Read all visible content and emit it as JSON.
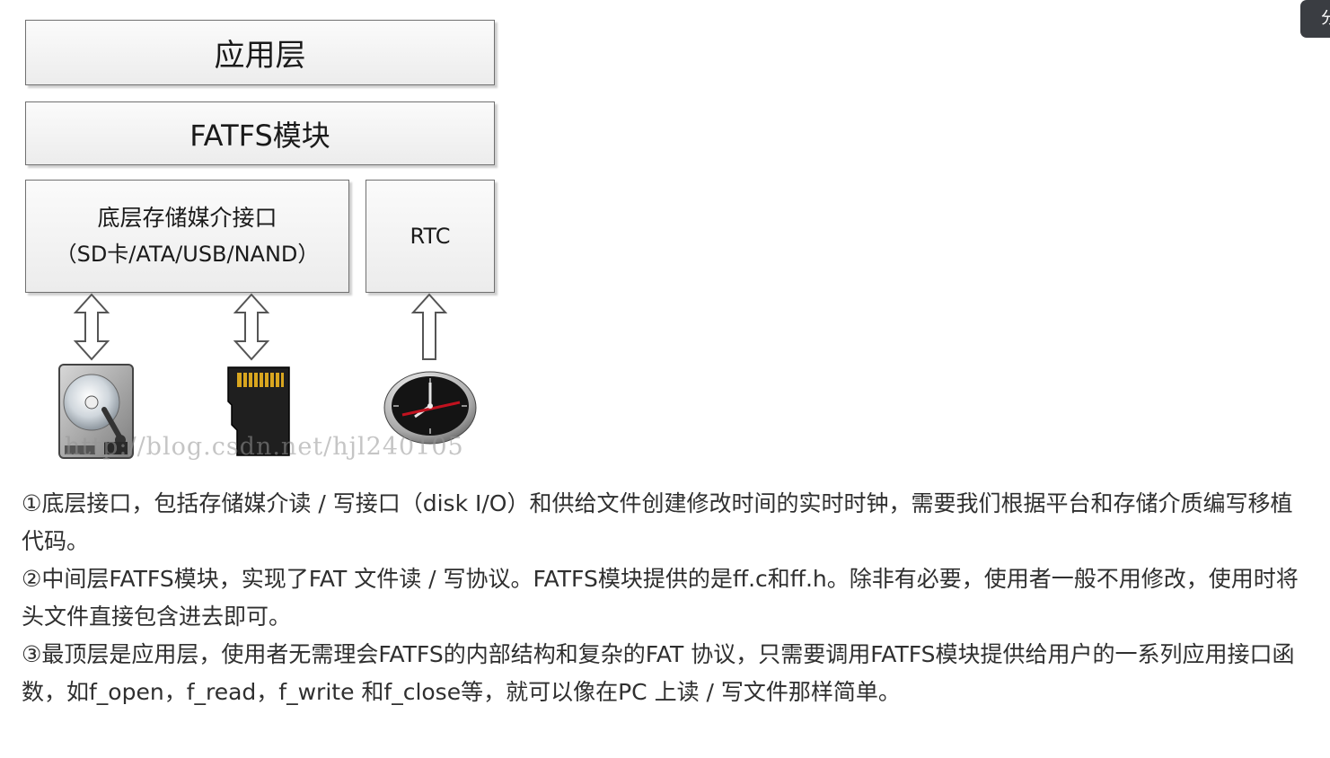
{
  "diagram": {
    "app_layer": "应用层",
    "fatfs_layer": "FATFS模块",
    "storage_layer": {
      "line1": "底层存储媒介接口",
      "line2": "（SD卡/ATA/USB/NAND）"
    },
    "rtc_layer": "RTC",
    "devices": {
      "hdd": "hard-disk-icon",
      "sd": "sd-card-icon",
      "clock": "clock-icon"
    },
    "watermark": "http://blog.csdn.net/hjl240105"
  },
  "description": {
    "p1": "①底层接口，包括存储媒介读 / 写接口（disk I/O）和供给文件创建修改时间的实时时钟，需要我们根据平台和存储介质编写移植代码。",
    "p2": "②中间层FATFS模块，实现了FAT 文件读 / 写协议。FATFS模块提供的是ff.c和ff.h。除非有必要，使用者一般不用修改，使用时将头文件直接包含进去即可。",
    "p3": "③最顶层是应用层，使用者无需理会FATFS的内部结构和复杂的FAT 协议，只需要调用FATFS模块提供给用户的一系列应用接口函数，如f_open，f_read，f_write 和f_close等，就可以像在PC 上读 / 写文件那样简单。"
  },
  "share_tab": "分",
  "colors": {
    "box_border": "#707070",
    "text": "#2f2f2f",
    "tab_bg": "#3a3d42"
  }
}
